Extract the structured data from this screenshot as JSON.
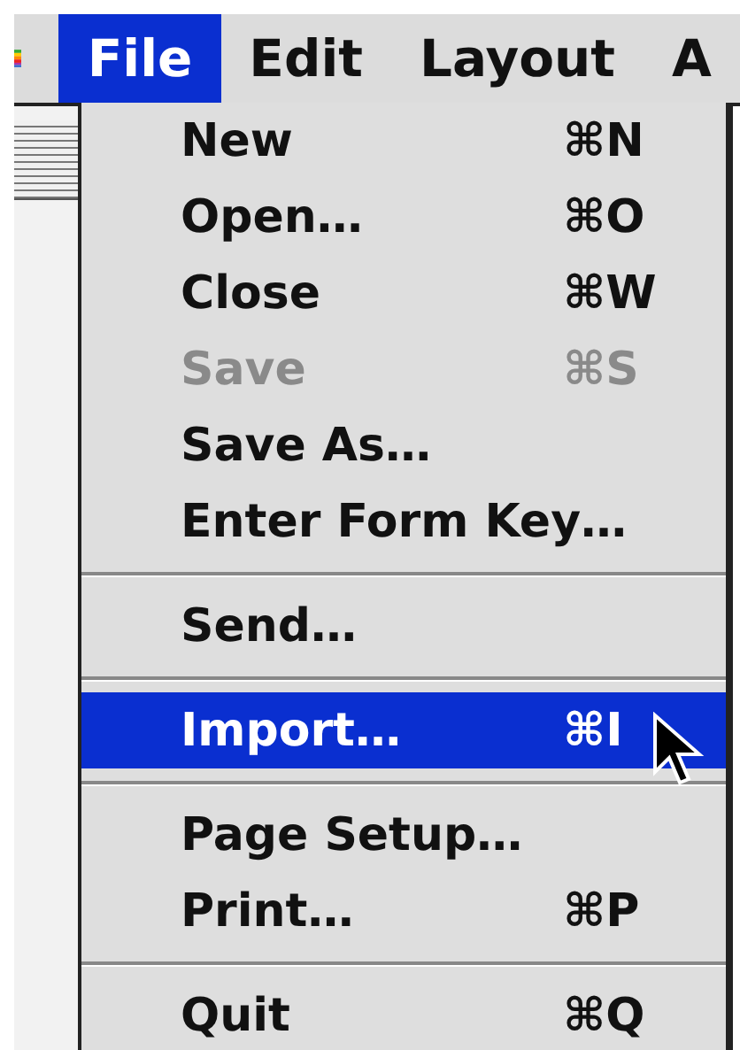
{
  "menu_bar": [
    {
      "label": "File",
      "selected": true
    },
    {
      "label": "Edit",
      "selected": false
    },
    {
      "label": "Layout",
      "selected": false
    },
    {
      "label": "A",
      "selected": false
    }
  ],
  "file_menu": [
    {
      "kind": "item",
      "label": "New",
      "shortcut": "⌘N",
      "disabled": false,
      "selected": false
    },
    {
      "kind": "item",
      "label": "Open…",
      "shortcut": "⌘O",
      "disabled": false,
      "selected": false
    },
    {
      "kind": "item",
      "label": "Close",
      "shortcut": "⌘W",
      "disabled": false,
      "selected": false
    },
    {
      "kind": "item",
      "label": "Save",
      "shortcut": "⌘S",
      "disabled": true,
      "selected": false
    },
    {
      "kind": "item",
      "label": "Save As…",
      "disabled": false,
      "selected": false
    },
    {
      "kind": "item",
      "label": "Enter Form Key…",
      "disabled": false,
      "selected": false
    },
    {
      "kind": "separator"
    },
    {
      "kind": "item",
      "label": "Send…",
      "disabled": false,
      "selected": false
    },
    {
      "kind": "separator"
    },
    {
      "kind": "item",
      "label": "Import…",
      "shortcut": "⌘I",
      "disabled": false,
      "selected": true
    },
    {
      "kind": "separator"
    },
    {
      "kind": "item",
      "label": "Page Setup…",
      "disabled": false,
      "selected": false
    },
    {
      "kind": "item",
      "label": "Print…",
      "shortcut": "⌘P",
      "disabled": false,
      "selected": false
    },
    {
      "kind": "separator"
    },
    {
      "kind": "item",
      "label": "Quit",
      "shortcut": "⌘Q",
      "disabled": false,
      "selected": false
    }
  ]
}
